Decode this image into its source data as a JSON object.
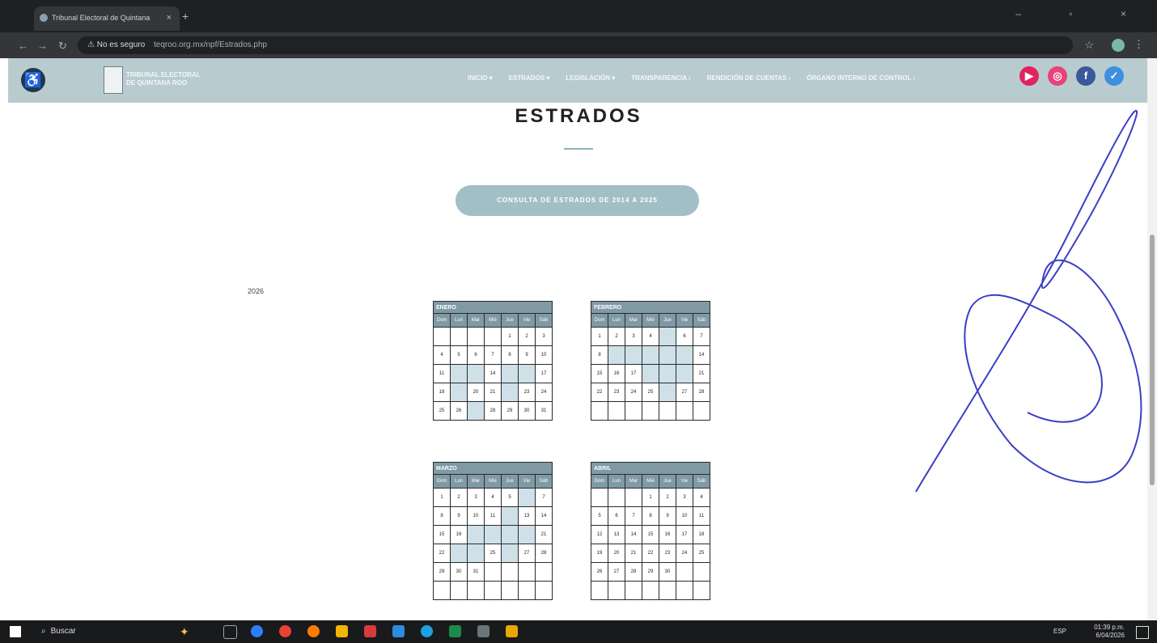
{
  "browser": {
    "tab_title": "Tribunal Electoral de Quintana",
    "tab_close": "×",
    "new_tab": "+",
    "security_label": "⚠ No es seguro",
    "url": "teqroo.org.mx/npf/Estrados.php",
    "window_buttons": "–  ▫  ×"
  },
  "header": {
    "logo_text_1": "TRIBUNAL ELECTORAL",
    "logo_text_2": "DE QUINTANA ROO",
    "nav": [
      "INICIO ▾",
      "ESTRADOS ▾",
      "LEGISLACIÓN ▾",
      "TRANSPARENCIA ›",
      "RENDICIÓN DE CUENTAS ›",
      "ÓRGANO INTERNO DE CONTROL ›"
    ]
  },
  "page": {
    "title": "ESTRADOS",
    "consult_button": "CONSULTA DE ESTRADOS DE 2014 A 2025",
    "year": "2026"
  },
  "calendars": [
    {
      "month": "ENERO",
      "days_header": [
        "Dom",
        "Lun",
        "Mar",
        "Mié",
        "Jue",
        "Vie",
        "Sáb"
      ],
      "weeks": [
        [
          "",
          "",
          "",
          "",
          "1",
          "2",
          "3"
        ],
        [
          "4",
          "5",
          "6",
          "7",
          "8",
          "9",
          "10"
        ],
        [
          "11",
          "",
          "",
          "14",
          "",
          "",
          "17"
        ],
        [
          "18",
          "",
          "20",
          "21",
          "",
          "23",
          "24"
        ],
        [
          "25",
          "26",
          "",
          "28",
          "29",
          "30",
          "31"
        ]
      ],
      "highlighted": [
        "12",
        "13",
        "15",
        "16",
        "19",
        "22",
        "27"
      ]
    },
    {
      "month": "FEBRERO",
      "days_header": [
        "Dom",
        "Lun",
        "Mar",
        "Mié",
        "Jue",
        "Vie",
        "Sáb"
      ],
      "weeks": [
        [
          "1",
          "2",
          "3",
          "4",
          "",
          "6",
          "7"
        ],
        [
          "8",
          "",
          "",
          "",
          "",
          "",
          "14"
        ],
        [
          "15",
          "16",
          "17",
          "",
          "",
          "",
          "21"
        ],
        [
          "22",
          "23",
          "24",
          "25",
          "",
          "27",
          "28"
        ],
        [
          "",
          "",
          "",
          "",
          "",
          "",
          ""
        ]
      ],
      "highlighted": [
        "5",
        "9",
        "10",
        "11",
        "12",
        "13",
        "18",
        "19",
        "20",
        "26"
      ]
    },
    {
      "month": "MARZO",
      "days_header": [
        "Dom",
        "Lun",
        "Mar",
        "Mié",
        "Jue",
        "Vie",
        "Sáb"
      ],
      "weeks": [
        [
          "1",
          "2",
          "3",
          "4",
          "5",
          "",
          "7"
        ],
        [
          "8",
          "9",
          "10",
          "11",
          "",
          "13",
          "14"
        ],
        [
          "15",
          "16",
          "",
          "",
          "",
          "",
          "21"
        ],
        [
          "22",
          "",
          "",
          "25",
          "",
          "27",
          "28"
        ],
        [
          "29",
          "30",
          "31",
          "",
          "",
          "",
          ""
        ],
        [
          "",
          "",
          "",
          "",
          "",
          "",
          ""
        ]
      ],
      "highlighted": [
        "6",
        "12",
        "17",
        "18",
        "19",
        "20",
        "23",
        "24",
        "26"
      ]
    },
    {
      "month": "ABRIL",
      "days_header": [
        "Dom",
        "Lun",
        "Mar",
        "Mié",
        "Jue",
        "Vie",
        "Sáb"
      ],
      "weeks": [
        [
          "",
          "",
          "",
          "1",
          "2",
          "3",
          "4"
        ],
        [
          "5",
          "6",
          "7",
          "8",
          "9",
          "10",
          "11"
        ],
        [
          "12",
          "13",
          "14",
          "15",
          "16",
          "17",
          "18"
        ],
        [
          "19",
          "20",
          "21",
          "22",
          "23",
          "24",
          "25"
        ],
        [
          "26",
          "27",
          "28",
          "29",
          "30",
          "",
          ""
        ],
        [
          "",
          "",
          "",
          "",
          "",
          "",
          ""
        ]
      ],
      "highlighted": []
    }
  ],
  "taskbar": {
    "search": "Buscar",
    "lang": "ESP",
    "time": "01:39 p.m.",
    "date": "6/04/2026"
  },
  "colors": {
    "header_bg": "#b8cccf",
    "table_header": "#7f9aa5",
    "highlight": "#cfe0e8",
    "button_bg": "#a2bfc6",
    "signature_ink": "#3b3fc4"
  }
}
